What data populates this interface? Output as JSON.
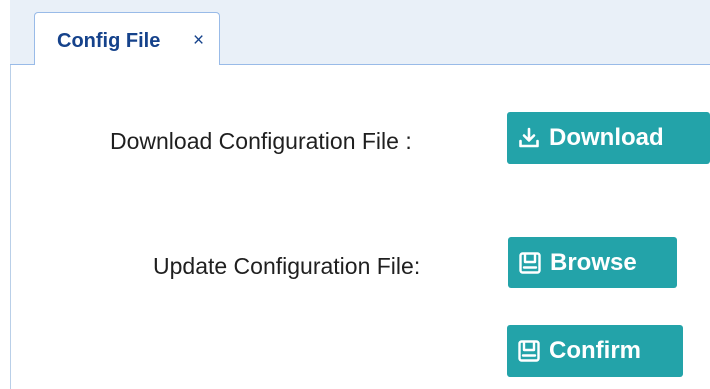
{
  "tab": {
    "label": "Config File",
    "close_glyph": "×"
  },
  "download_row": {
    "label": "Download Configuration File :",
    "button_label": "Download",
    "button_icon": "download-icon"
  },
  "update_row": {
    "label": "Update Configuration File:",
    "browse_label": "Browse",
    "browse_icon": "floppy-disk-icon",
    "confirm_label": "Confirm",
    "confirm_icon": "floppy-disk-icon"
  },
  "colors": {
    "button_bg": "#23a3a9",
    "tab_text": "#15428b",
    "tab_border": "#99bbe8",
    "tab_strip_bg": "#e9f0f8"
  }
}
